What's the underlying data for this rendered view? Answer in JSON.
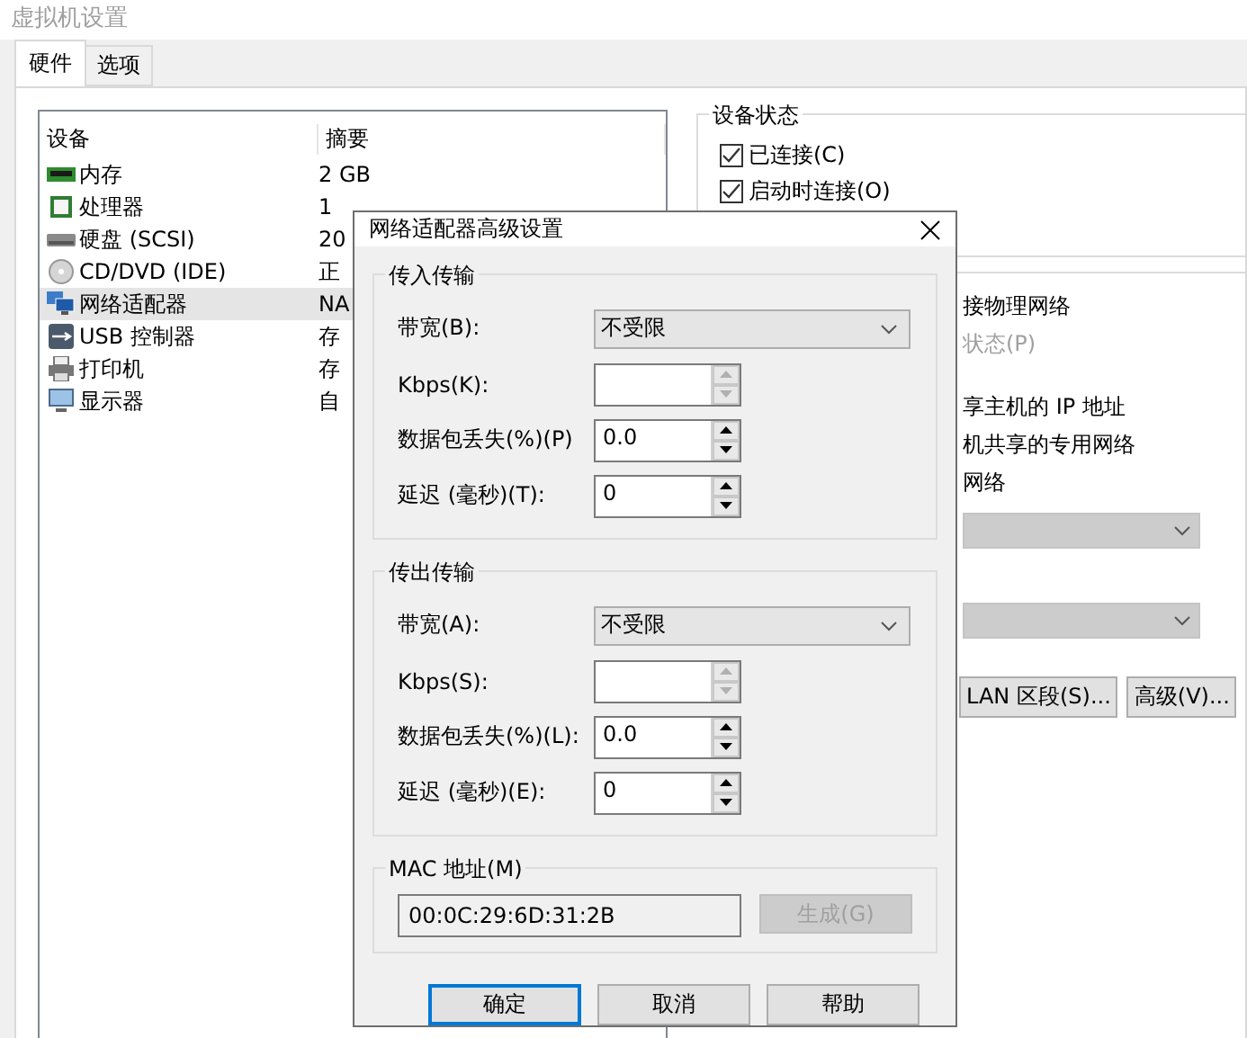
{
  "window": {
    "title": "虚拟机设置"
  },
  "tabs": [
    {
      "label": "硬件",
      "selected": true
    },
    {
      "label": "选项",
      "selected": false
    }
  ],
  "device_list": {
    "columns": [
      "设备",
      "摘要"
    ],
    "rows": [
      {
        "device": "内存",
        "summary": "2 GB",
        "kind": "memory",
        "selected": false
      },
      {
        "device": "处理器",
        "summary": "1",
        "kind": "cpu",
        "selected": false
      },
      {
        "device": "硬盘 (SCSI)",
        "summary": "20",
        "kind": "disk",
        "selected": false
      },
      {
        "device": "CD/DVD (IDE)",
        "summary": "正",
        "kind": "cd",
        "selected": false
      },
      {
        "device": "网络适配器",
        "summary": "NA",
        "kind": "network",
        "selected": true
      },
      {
        "device": "USB 控制器",
        "summary": "存",
        "kind": "usb",
        "selected": false
      },
      {
        "device": "打印机",
        "summary": "存",
        "kind": "printer",
        "selected": false
      },
      {
        "device": "显示器",
        "summary": "自",
        "kind": "display",
        "selected": false
      }
    ]
  },
  "device_status": {
    "title": "设备状态",
    "checkboxes": [
      {
        "label": "已连接(C)",
        "checked": true
      },
      {
        "label": "启动时连接(O)",
        "checked": true
      }
    ]
  },
  "network_connection": {
    "options": [
      {
        "label": "接物理网络",
        "disabled": false
      },
      {
        "label": "状态(P)",
        "disabled": true
      },
      {
        "label": "享主机的 IP 地址",
        "disabled": false
      },
      {
        "label": "机共享的专用网络",
        "disabled": false
      },
      {
        "label": "网络",
        "disabled": false
      }
    ],
    "buttons": [
      "LAN 区段(S)...",
      "高级(V)..."
    ]
  },
  "dialog": {
    "title": "网络适配器高级设置",
    "groups": [
      {
        "title": "传入传输",
        "bandwidth": {
          "label": "带宽(B):",
          "value": "不受限"
        },
        "fields": [
          {
            "label": "Kbps(K):",
            "disabled": true
          },
          {
            "label": "数据包丢失(%)(P)",
            "value": "0.0",
            "disabled": false
          },
          {
            "label": "延迟 (毫秒)(T):",
            "value": "0",
            "disabled": false
          }
        ]
      },
      {
        "title": "传出传输",
        "bandwidth": {
          "label": "带宽(A):",
          "value": "不受限"
        },
        "fields": [
          {
            "label": "Kbps(S):",
            "disabled": true
          },
          {
            "label": "数据包丢失(%)(L):",
            "value": "0.0",
            "disabled": false
          },
          {
            "label": "延迟 (毫秒)(E):",
            "value": "0",
            "disabled": false
          }
        ]
      }
    ],
    "mac": {
      "title": "MAC 地址(M)",
      "value": "00:0C:29:6D:31:2B",
      "button": {
        "label": "生成(G)",
        "disabled": true
      }
    },
    "buttons": [
      {
        "label": "确定",
        "default": true
      },
      {
        "label": "取消",
        "default": false
      },
      {
        "label": "帮助",
        "default": false
      }
    ]
  }
}
